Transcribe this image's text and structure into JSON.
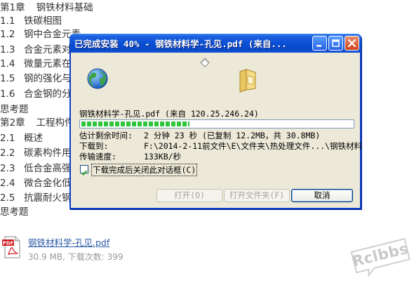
{
  "toc": [
    {
      "num": "第1章",
      "text": "钢铁材料基础",
      "chapter": true
    },
    {
      "num": "1.1",
      "text": "铁碳相图"
    },
    {
      "num": "1.2",
      "text": "钢中合金元素"
    },
    {
      "num": "1.3",
      "text": "合金元素对"
    },
    {
      "num": "1.4",
      "text": "微量元素在"
    },
    {
      "num": "1.5",
      "text": "钢的强化与"
    },
    {
      "num": "1.6",
      "text": "合金钢的分"
    },
    {
      "num": "",
      "text": "思考题"
    },
    {
      "num": "第2章",
      "text": "工程构件",
      "chapter": true
    },
    {
      "num": "2.1",
      "text": "概述"
    },
    {
      "num": "2.2",
      "text": "碳素构件用"
    },
    {
      "num": "2.3",
      "text": "低合金高强"
    },
    {
      "num": "2.4",
      "text": "微合金化低"
    },
    {
      "num": "2.5",
      "text": "抗震耐火钢"
    },
    {
      "num": "",
      "text": "思考题"
    }
  ],
  "attachment": {
    "icon": "pdf-file-icon",
    "filename": "钢铁材料学-孔见.pdf",
    "meta": "30.9 MB, 下载次数: 399"
  },
  "watermark": {
    "text": "Rclbbs"
  },
  "dialog": {
    "title": "已完成安装 40% - 钢铁材料学-孔见.pdf (来自...",
    "file_line": "钢铁材料学-孔见.pdf (来自 120.25.246.24)",
    "progress_pct": 40,
    "rows": [
      {
        "label": "估计剩余时间:",
        "value": "2 分钟 23 秒 (已复制 12.2MB，共 30.8MB)"
      },
      {
        "label": "下载到:",
        "value": "F:\\2014-2-11前文件\\E\\文件夹\\热处理文件...\\钢铁材料"
      },
      {
        "label": "传输速度:",
        "value": "133KB/秒"
      }
    ],
    "checkbox_label": "下载完成后关闭此对话框(C)",
    "checkbox_checked": true,
    "buttons": {
      "open": "打开(O)",
      "open_folder": "打开文件夹(F)",
      "cancel": "取消"
    },
    "icons": {
      "globe": "globe-icon",
      "document": "flying-document-icon",
      "folder": "folder-icon",
      "minimize": "minimize-icon",
      "maximize": "maximize-icon",
      "close": "close-icon"
    }
  }
}
